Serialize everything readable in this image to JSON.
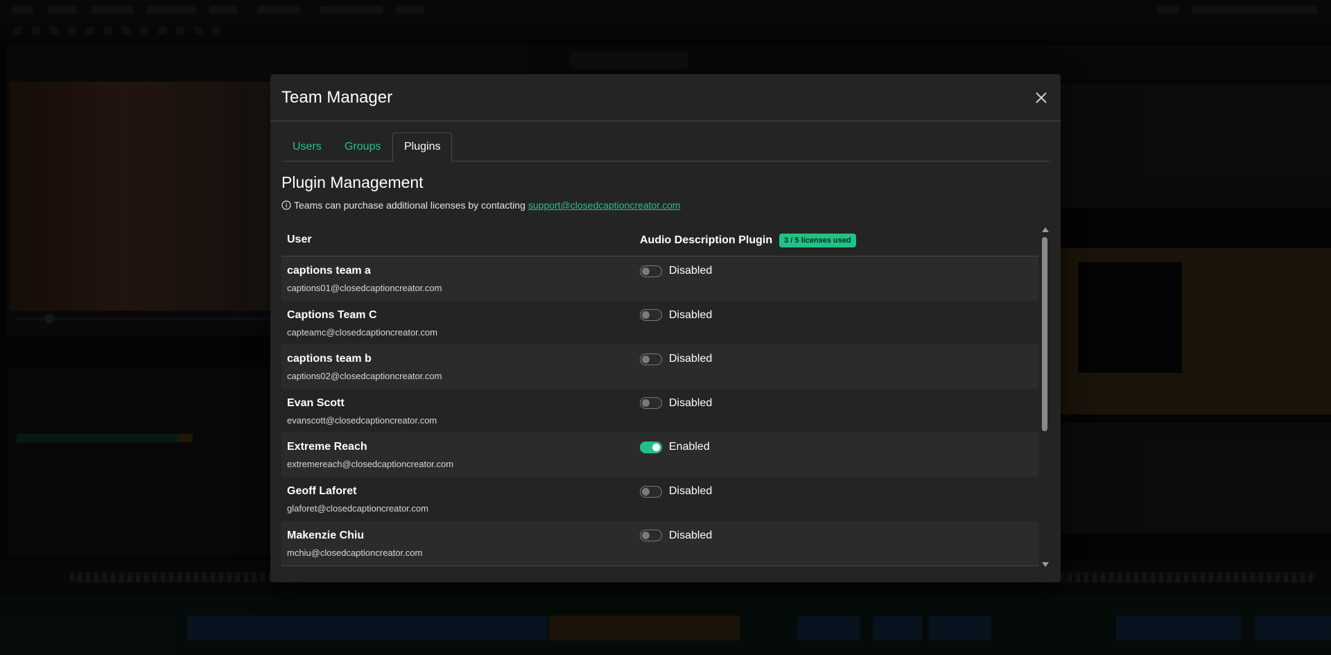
{
  "modal": {
    "title": "Team Manager",
    "close_icon": "close-icon"
  },
  "tabs": [
    {
      "label": "Users",
      "active": false
    },
    {
      "label": "Groups",
      "active": false
    },
    {
      "label": "Plugins",
      "active": true
    }
  ],
  "plugin_management": {
    "title": "Plugin Management",
    "info_text": "Teams can purchase additional licenses by contacting",
    "info_link": "support@closedcaptioncreator.com",
    "info_icon": "info-icon"
  },
  "table": {
    "col_user": "User",
    "col_plugin": "Audio Description Plugin",
    "license_badge": "3 / 5 licenses used",
    "rows": [
      {
        "name": "captions team a",
        "email": "captions01@closedcaptioncreator.com",
        "enabled": false,
        "status": "Disabled"
      },
      {
        "name": "Captions Team C",
        "email": "capteamc@closedcaptioncreator.com",
        "enabled": false,
        "status": "Disabled"
      },
      {
        "name": "captions team b",
        "email": "captions02@closedcaptioncreator.com",
        "enabled": false,
        "status": "Disabled"
      },
      {
        "name": "Evan Scott",
        "email": "evanscott@closedcaptioncreator.com",
        "enabled": false,
        "status": "Disabled"
      },
      {
        "name": "Extreme Reach",
        "email": "extremereach@closedcaptioncreator.com",
        "enabled": true,
        "status": "Enabled"
      },
      {
        "name": "Geoff Laforet",
        "email": "glaforet@closedcaptioncreator.com",
        "enabled": false,
        "status": "Disabled"
      },
      {
        "name": "Makenzie Chiu",
        "email": "mchiu@closedcaptioncreator.com",
        "enabled": false,
        "status": "Disabled"
      }
    ]
  },
  "colors": {
    "accent": "#20c285",
    "link": "#2bbf8a",
    "modal_bg": "#242424"
  }
}
